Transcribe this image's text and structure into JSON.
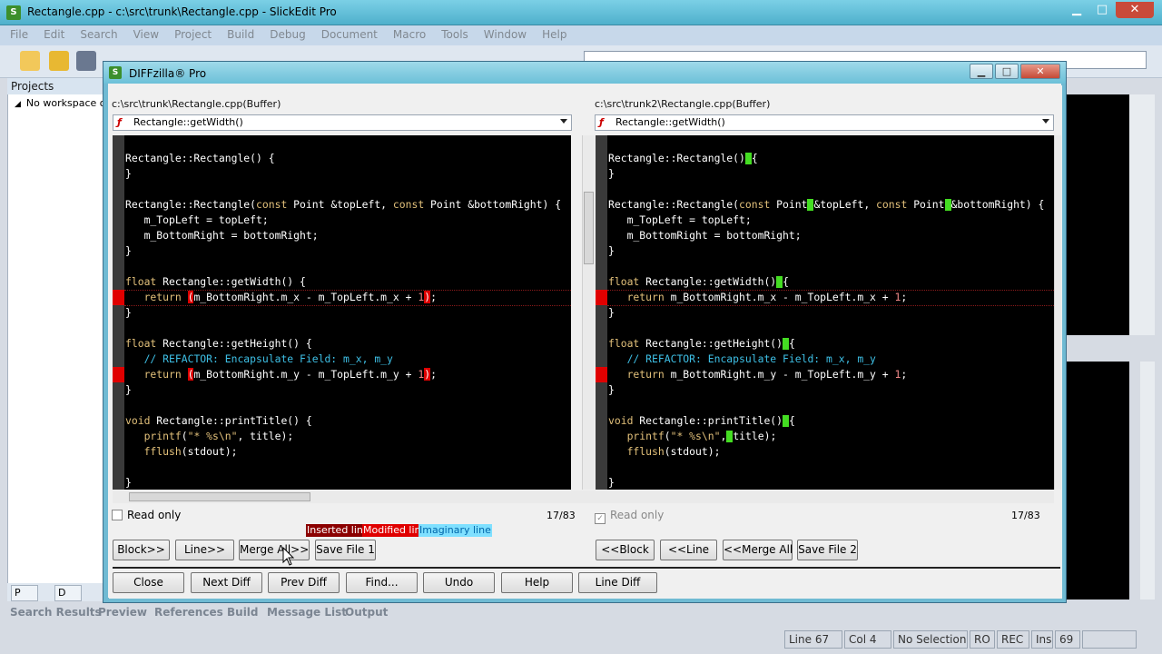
{
  "main_window": {
    "title": "Rectangle.cpp - c:\\src\\trunk\\Rectangle.cpp - SlickEdit Pro",
    "min": "▁",
    "max": "□",
    "close": "✕"
  },
  "menu": [
    "File",
    "Edit",
    "Search",
    "View",
    "Project",
    "Build",
    "Debug",
    "Document",
    "Macro",
    "Tools",
    "Window",
    "Help"
  ],
  "context_combo": "Rectangle::getWidth() ...",
  "projects": {
    "title": "Projects",
    "workspace": "No workspace op",
    "tabs": [
      "P",
      "D"
    ]
  },
  "bottom_tabs": [
    "Search Results",
    "Preview",
    "References",
    "Build",
    "Message List",
    "Output"
  ],
  "status": {
    "line": "Line 67",
    "col": "Col 4",
    "sel": "No Selection",
    "ro": "RO",
    "rec": "REC",
    "ins": "Ins",
    "num": "69"
  },
  "dialog": {
    "title": "DIFFzilla® Pro",
    "left": {
      "path": "c:\\src\\trunk\\Rectangle.cpp(Buffer)",
      "func": "Rectangle::getWidth()",
      "readonly": "Read only",
      "count": "17/83"
    },
    "right": {
      "path": "c:\\src\\trunk2\\Rectangle.cpp(Buffer)",
      "func": "Rectangle::getWidth()",
      "readonly": "Read only",
      "count": "17/83"
    },
    "legend": {
      "inserted": "Inserted line",
      "modified": "Modified line",
      "imaginary": "Imaginary line"
    },
    "left_buttons": [
      "Block>>",
      "Line>>",
      "Merge All>>",
      "Save File 1"
    ],
    "right_buttons": [
      "<<Block",
      "<<Line",
      "<<Merge All",
      "Save File 2"
    ],
    "bottom_buttons": [
      "Close",
      "Next Diff",
      "Prev Diff",
      "Find...",
      "Undo",
      "Help",
      "Line Diff"
    ],
    "colors": {
      "inserted": "#8b0000",
      "modified": "#e00000",
      "imaginary": "#7fe0ff"
    }
  }
}
